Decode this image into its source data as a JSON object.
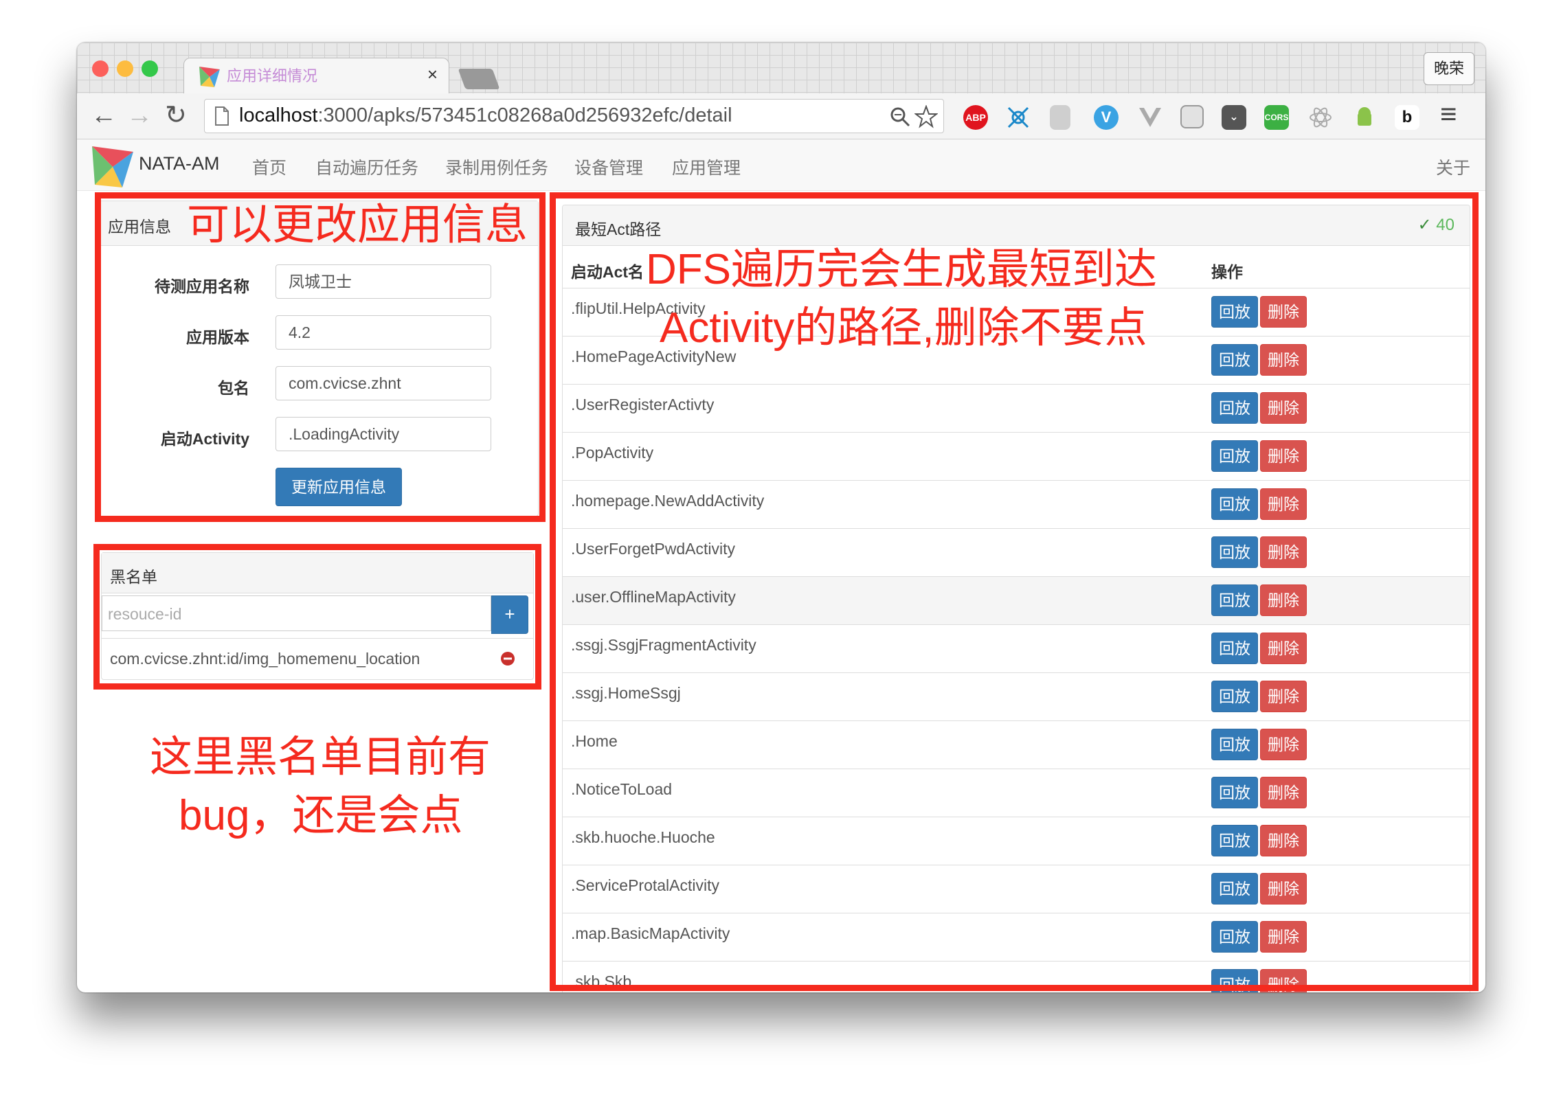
{
  "browser": {
    "tab_title": "应用详细情况",
    "tab_close": "×",
    "profile": "晚荣",
    "url_host": "localhost",
    "url_path": ":3000/apks/573451c08268a0d256932efc/detail",
    "back_glyph": "←",
    "forward_glyph": "→",
    "reload_glyph": "↻",
    "menu_glyph": "≡",
    "ext_abp": "ABP",
    "ext_cors": "CORS",
    "colors": {
      "close": "#fc605b",
      "minimize": "#fdbc40",
      "maximize": "#34c84a"
    }
  },
  "navbar": {
    "brand": "NATA-AM",
    "links": [
      "首页",
      "自动遍历任务",
      "录制用例任务",
      "设备管理",
      "应用管理"
    ],
    "about": "关于"
  },
  "app_info": {
    "heading": "应用信息",
    "fields": [
      {
        "label": "待测应用名称",
        "value": "凤城卫士"
      },
      {
        "label": "应用版本",
        "value": "4.2"
      },
      {
        "label": "包名",
        "value": "com.cvicse.zhnt"
      },
      {
        "label": "启动Activity",
        "value": ".LoadingActivity"
      }
    ],
    "update_button": "更新应用信息"
  },
  "blacklist": {
    "heading": "黑名单",
    "input_placeholder": "resouce-id",
    "add_button": "+",
    "items": [
      "com.cvicse.zhnt:id/img_homemenu_location"
    ]
  },
  "shortest_path": {
    "heading": "最短Act路径",
    "check_glyph": "✓",
    "count": "40",
    "col_name": "启动Act名",
    "col_ops": "操作",
    "replay_label": "回放",
    "delete_label": "删除",
    "rows": [
      ".flipUtil.HelpActivity",
      ".HomePageActivityNew",
      ".UserRegisterActivty",
      ".PopActivity",
      ".homepage.NewAddActivity",
      ".UserForgetPwdActivity",
      ".user.OfflineMapActivity",
      ".ssgj.SsgjFragmentActivity",
      ".ssgj.HomeSsgj",
      ".Home",
      ".NoticeToLoad",
      ".skb.huoche.Huoche",
      ".ServiceProtalActivity",
      ".map.BasicMapActivity",
      ".skb.Skb"
    ],
    "highlighted_row": 6
  },
  "annotations": {
    "app_info_note": "可以更改应用信息",
    "path_note_line1": "DFS遍历完会生成最短到达",
    "path_note_line2": "Activity的路径,删除不要点",
    "blacklist_note_line1": "这里黑名单目前有",
    "blacklist_note_line2": "bug，还是会点",
    "color": "#f52a1e"
  }
}
